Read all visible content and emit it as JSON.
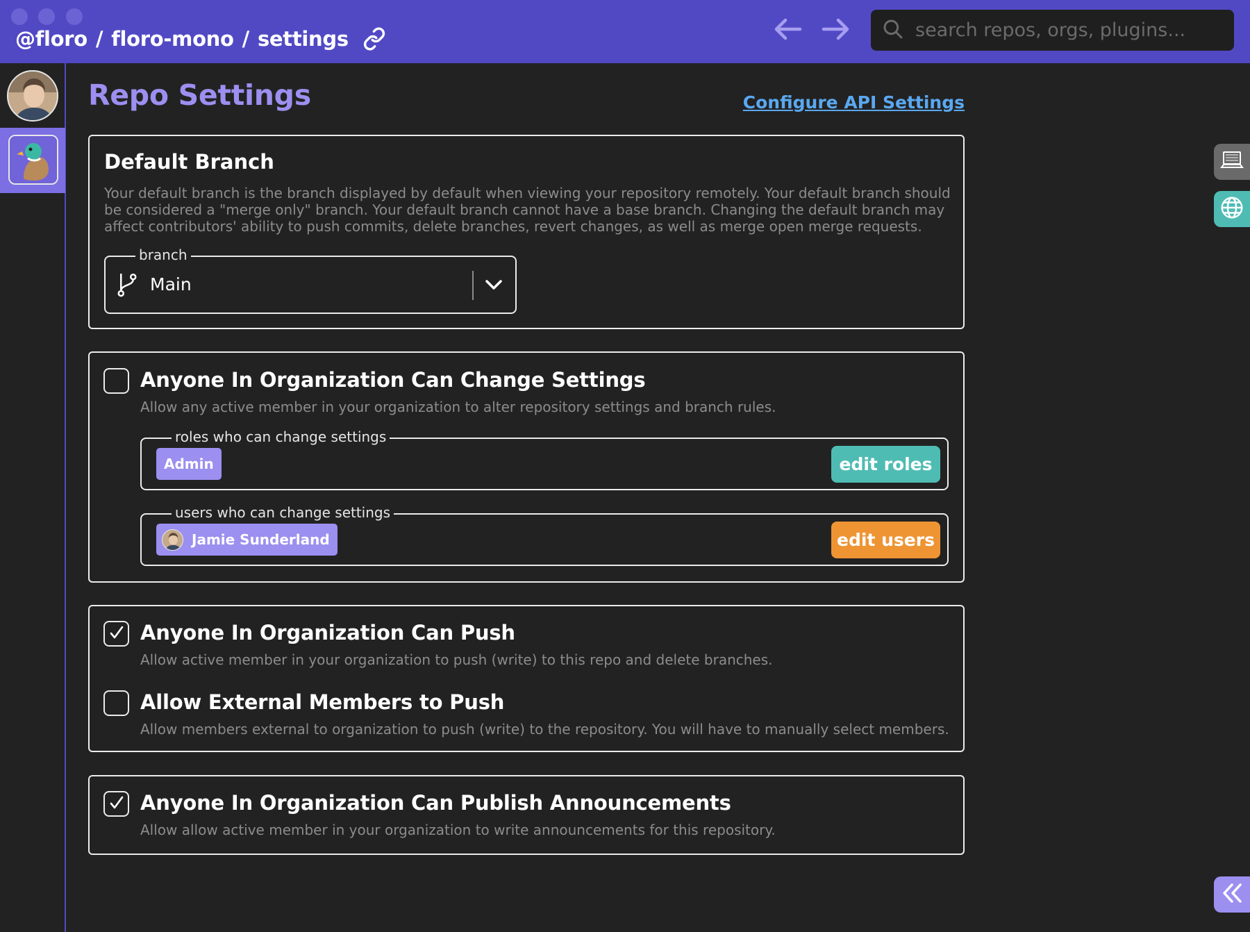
{
  "breadcrumb": {
    "owner": "@floro",
    "repo": "floro-mono",
    "page": "settings",
    "separator": "/"
  },
  "search": {
    "placeholder": "search repos, orgs, plugins..."
  },
  "page": {
    "title": "Repo Settings",
    "api_link": "Configure API Settings"
  },
  "default_branch": {
    "title": "Default Branch",
    "description": "Your default branch is the branch displayed by default when viewing your repository remotely. Your default branch should be considered a \"merge only\" branch. Your default branch cannot have a base branch. Changing the default branch may affect contributors' ability to push commits, delete branches, revert changes, as well as merge open merge requests.",
    "select_label": "branch",
    "selected": "Main"
  },
  "change_settings": {
    "checked": false,
    "title": "Anyone In Organization Can Change Settings",
    "description": "Allow any active member in your organization to alter repository settings and branch rules.",
    "roles_label": "roles who can change settings",
    "roles": [
      "Admin"
    ],
    "edit_roles": "edit roles",
    "users_label": "users who can change settings",
    "users": [
      "Jamie Sunderland"
    ],
    "edit_users": "edit users"
  },
  "push": {
    "can_push": {
      "checked": true,
      "title": "Anyone In Organization Can Push",
      "description": "Allow active member in your organization to push (write) to this repo and delete branches."
    },
    "external": {
      "checked": false,
      "title": "Allow External Members to Push",
      "description": "Allow members external to organization to push (write) to the repository. You will have to manually select members."
    }
  },
  "announcements": {
    "checked": true,
    "title": "Anyone In Organization Can Publish Announcements",
    "description": "Allow allow active member in your organization to write announcements for this repository."
  },
  "icons": {
    "link": "link-icon",
    "back": "arrow-left-icon",
    "forward": "arrow-right-icon",
    "search": "search-icon",
    "branch": "git-branch-icon",
    "dropdown": "chevron-down-icon",
    "check": "checkmark-icon",
    "laptop": "laptop-icon",
    "globe": "globe-icon",
    "collapse": "double-chevron-left-icon"
  },
  "colors": {
    "titlebar": "#5149c4",
    "accent": "#9c8ff0",
    "link": "#5aa8f0",
    "teal": "#4fbcb4",
    "orange": "#ef9433",
    "background": "#222222"
  }
}
